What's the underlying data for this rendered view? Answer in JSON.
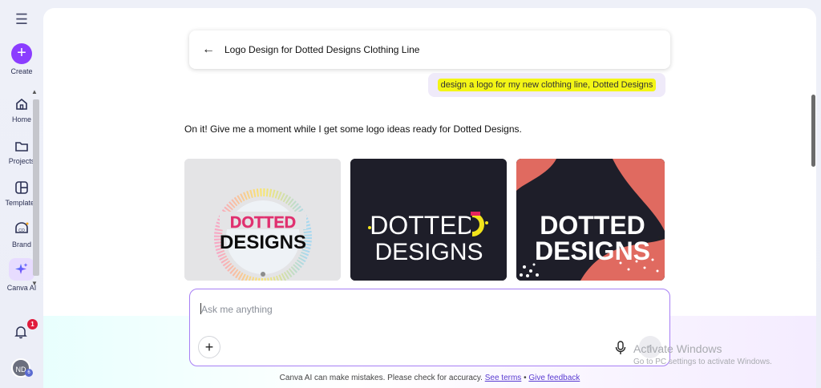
{
  "rail": {
    "create_label": "Create",
    "items": [
      {
        "label": "Home",
        "icon": "home-icon"
      },
      {
        "label": "Projects",
        "icon": "folder-icon"
      },
      {
        "label": "Templates",
        "icon": "template-icon"
      },
      {
        "label": "Brand",
        "icon": "brand-icon"
      },
      {
        "label": "Canva AI",
        "icon": "sparkle-icon"
      }
    ],
    "notification_count": "1",
    "avatar_initials": "ND",
    "avatar_badge": "6"
  },
  "header": {
    "title": "Logo Design for Dotted Designs Clothing Line"
  },
  "chat": {
    "user_message": "design a logo for my new clothing line, Dotted Designs",
    "ai_message": "On it! Give me a moment while I get some logo ideas ready for Dotted Designs."
  },
  "logos": [
    {
      "line1": "DOTTED",
      "line2": "DESIGNS"
    },
    {
      "line1": "DOTTED",
      "line2": "DESIGNS"
    },
    {
      "line1": "DOTTED",
      "line2": "DESIGNS"
    }
  ],
  "input": {
    "placeholder": "Ask me anything"
  },
  "footer": {
    "note": "Canva AI can make mistakes. Please check for accuracy.",
    "terms_link": "See terms",
    "separator": "•",
    "feedback_link": "Give feedback"
  },
  "watermark": {
    "title": "Activate Windows",
    "subtitle": "Go to PC settings to activate Windows."
  },
  "colors": {
    "accent": "#8b3dff",
    "highlight": "#f3f516",
    "badge": "#e01b3c"
  }
}
